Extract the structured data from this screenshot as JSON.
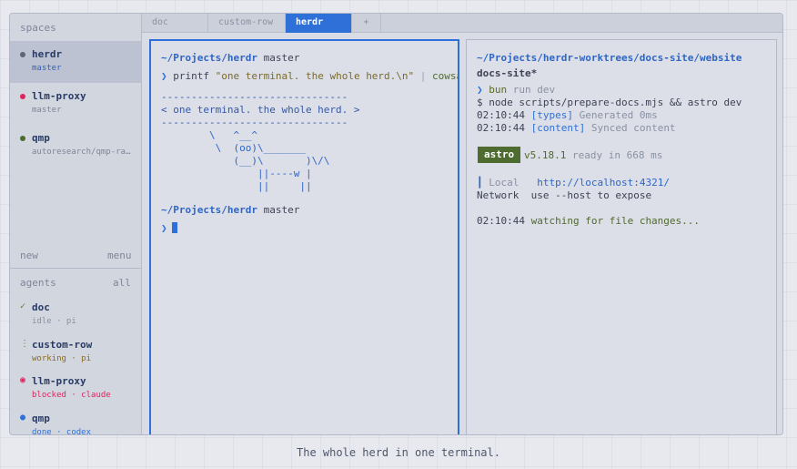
{
  "sidebar": {
    "spaces_title": "spaces",
    "spaces": [
      {
        "name": "herdr",
        "branch": "master",
        "dot_color": "#5c6478",
        "active": true
      },
      {
        "name": "llm-proxy",
        "branch": "master",
        "dot_color": "#e0245e",
        "active": false
      },
      {
        "name": "qmp",
        "branch": "autoresearch/qmp-ra…",
        "dot_color": "#4c6b2e",
        "active": false
      }
    ],
    "new_label": "new",
    "menu_label": "menu",
    "agents_title": "agents",
    "agents_all": "all",
    "agents": [
      {
        "mark": "✓",
        "name": "doc",
        "meta": "idle · pi",
        "color": "#5a7a2e"
      },
      {
        "mark": "⋮",
        "name": "custom-row",
        "meta": "working · pi",
        "color": "#8a6a1e"
      },
      {
        "mark": "◉",
        "name": "llm-proxy",
        "meta": "blocked · claude",
        "color": "#e0245e"
      },
      {
        "mark": "●",
        "name": "qmp",
        "meta": "done · codex",
        "color": "#2f70d8"
      }
    ]
  },
  "tabs": [
    {
      "label": "doc",
      "active": false
    },
    {
      "label": "custom-row",
      "active": false
    },
    {
      "label": "herdr",
      "active": true
    },
    {
      "label": "+",
      "active": false
    }
  ],
  "left_pane": {
    "prompt_path": "~/Projects/herdr",
    "prompt_branch": "master",
    "prompt_symbol": "❯",
    "cmd_name": "printf",
    "cmd_string": "\"one terminal. the whole herd.\\n\"",
    "cmd_pipe": "|",
    "cmd_cowsay": "cowsay",
    "cow_lines": [
      "-------------------------------",
      "< one terminal. the whole herd. >",
      "-------------------------------",
      "        \\   ^__^",
      "         \\  (oo)\\_______",
      "            (__)\\       )\\/\\",
      "                ||----w |",
      "                ||     ||"
    ],
    "prompt2_path": "~/Projects/herdr",
    "prompt2_branch": "master"
  },
  "right_pane": {
    "path": "~/Projects/herdr-worktrees/docs-site/website",
    "branch": "docs-site*",
    "run_cmd": "bun",
    "run_args": "run dev",
    "exec_line": "$ node scripts/prepare-docs.mjs && astro dev",
    "log1_time": "02:10:44",
    "log1_tag": "[types]",
    "log1_msg": "Generated 0ms",
    "log2_time": "02:10:44",
    "log2_tag": "[content]",
    "log2_msg": "Synced content",
    "astro_badge": "astro",
    "astro_version": "v5.18.1",
    "astro_ready": "ready in 668 ms",
    "local_label": "Local",
    "local_url": "http://localhost:4321/",
    "network_label": "Network",
    "network_msg": "use --host to expose",
    "watch_time": "02:10:44",
    "watch_msg": "watching for file changes..."
  },
  "caption": "The whole herd in one terminal."
}
